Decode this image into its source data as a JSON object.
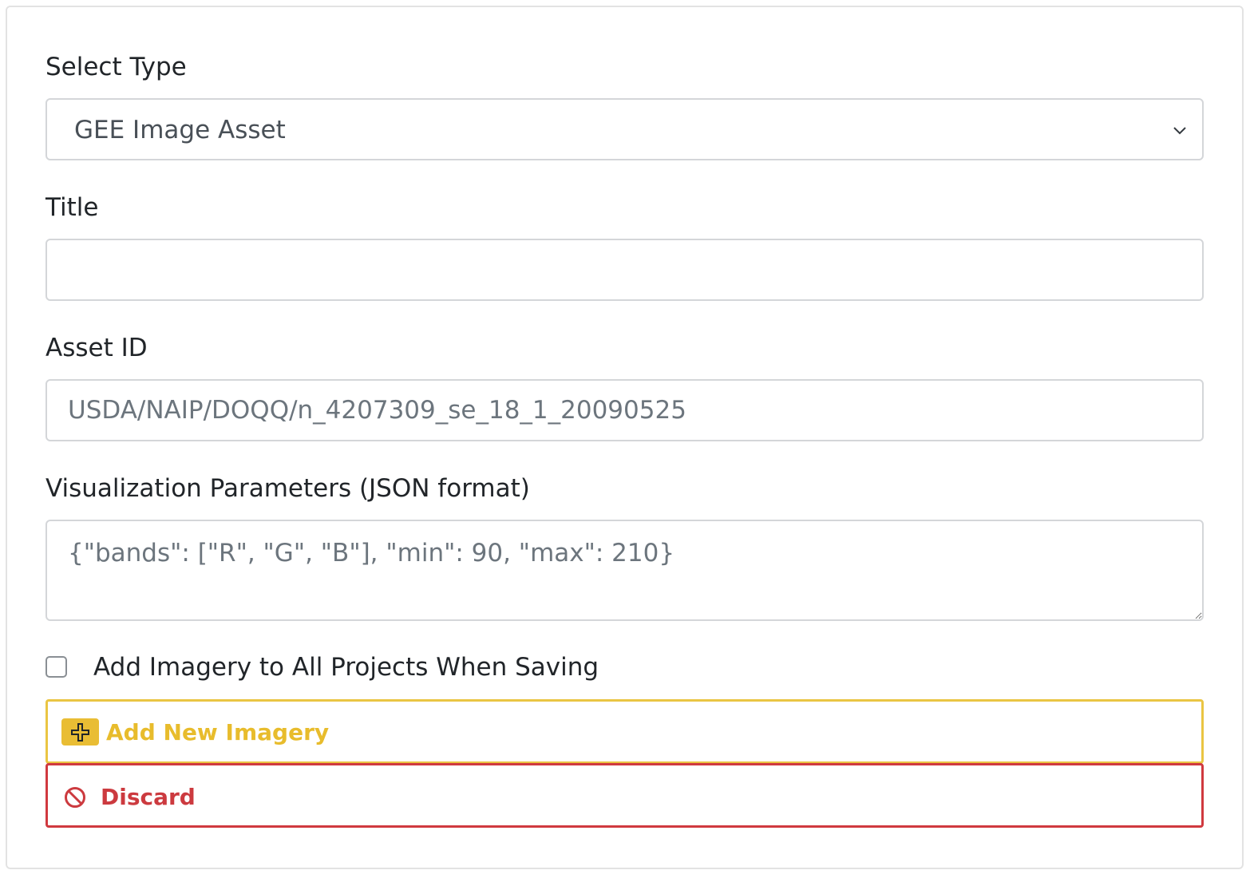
{
  "form": {
    "type_label": "Select Type",
    "type_selected": "GEE Image Asset",
    "title_label": "Title",
    "title_value": "",
    "asset_label": "Asset ID",
    "asset_placeholder": "USDA/NAIP/DOQQ/n_4207309_se_18_1_20090525",
    "vis_label": "Visualization Parameters (JSON format)",
    "vis_placeholder": "{\"bands\": [\"R\", \"G\", \"B\"], \"min\": 90, \"max\": 210}",
    "checkbox_label": "Add Imagery to All Projects When Saving",
    "checkbox_checked": false
  },
  "buttons": {
    "add_label": "Add New Imagery",
    "add_icon": "plus-square-icon",
    "discard_label": "Discard",
    "discard_icon": "ban-icon"
  },
  "colors": {
    "add_accent": "#eac543",
    "discard_accent": "#d0393f"
  }
}
